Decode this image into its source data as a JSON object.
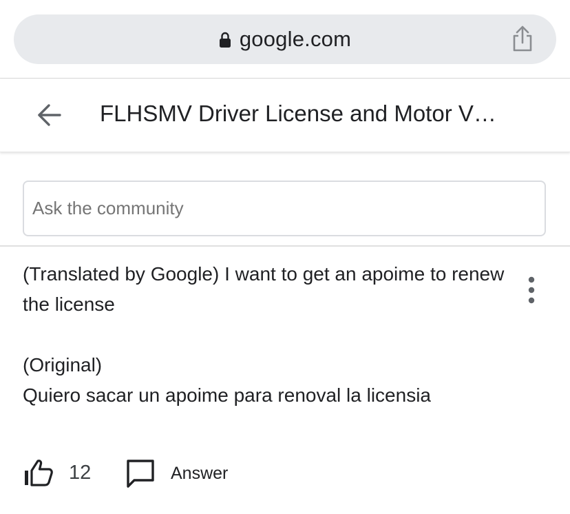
{
  "browser": {
    "url": "google.com",
    "lock_icon": "lock-icon",
    "share_icon": "share-icon"
  },
  "header": {
    "title": "FLHSMV Driver License and Motor V…",
    "back_icon": "arrow-left-icon"
  },
  "ask": {
    "placeholder": "Ask the community",
    "value": ""
  },
  "post": {
    "translated": "(Translated by Google) I want to get an apoime to renew the license",
    "original_label": "(Original)",
    "original_text": "Quiero sacar un apoime para renoval la licensia",
    "more_icon": "more-vert-icon"
  },
  "actions": {
    "like_count": "12",
    "answer_label": "Answer"
  },
  "colors": {
    "url_bar_bg": "#e8eaed",
    "text_primary": "#202124",
    "icon_gray": "#5f6368",
    "placeholder": "#757575"
  }
}
